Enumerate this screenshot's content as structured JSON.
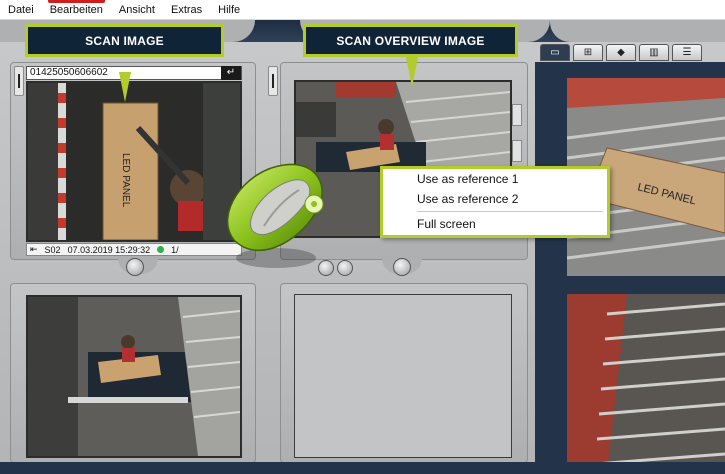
{
  "menu": [
    "Datei",
    "Bearbeiten",
    "Ansicht",
    "Extras",
    "Hilfe"
  ],
  "callouts": {
    "scan_image": "SCAN IMAGE",
    "scan_overview_image": "SCAN OVERVIEW IMAGE"
  },
  "scan_panel": {
    "barcode": "01425050606602",
    "enter_icon": "enter-arrow-icon",
    "status": {
      "station": "S02",
      "datetime": "07.03.2019 15:29:32",
      "counter": "1/"
    },
    "image_text": "LED PANEL"
  },
  "right_pane": {
    "toolbar_icons": [
      "screen-icon",
      "grid-icon",
      "box-icon",
      "map-icon",
      "list-icon"
    ],
    "image_text": "LED PANEL"
  },
  "context_menu": {
    "items": [
      "Use as reference 1",
      "Use as reference 2",
      "Full screen"
    ]
  },
  "colors": {
    "accent": "#b3cc2c",
    "callout_bg": "#102437",
    "dark_blue": "#23344a",
    "status_green": "#2bb24a",
    "menu_red": "#d21d1d"
  }
}
